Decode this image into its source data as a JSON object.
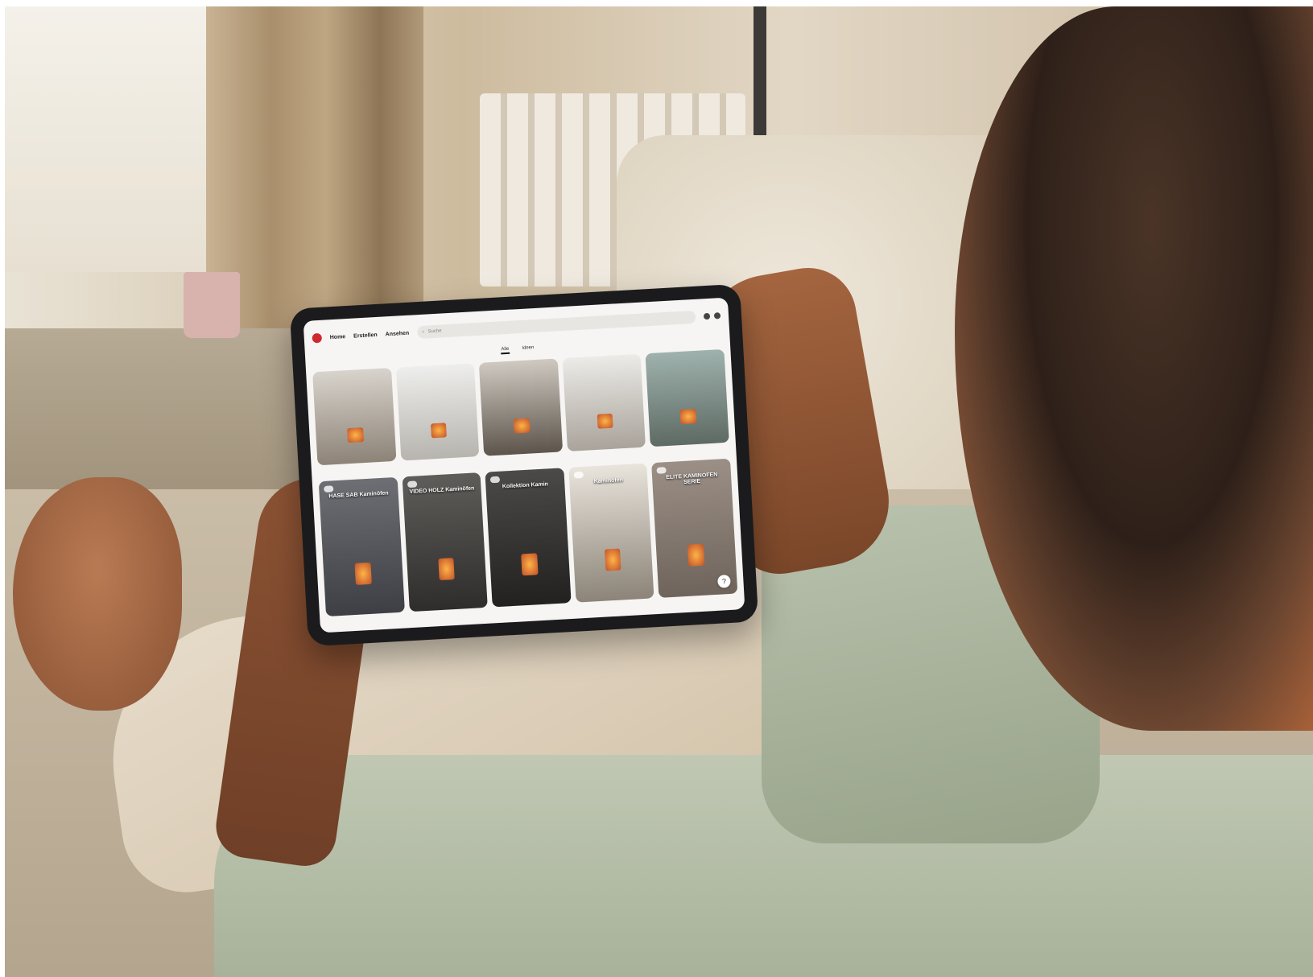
{
  "app": {
    "nav": [
      "Home",
      "Erstellen",
      "Ansehen"
    ],
    "search_placeholder": "Suche"
  },
  "tabs": [
    "Alle",
    "Ideen"
  ],
  "pins": [
    {
      "text": ""
    },
    {
      "text": ""
    },
    {
      "text": ""
    },
    {
      "text": ""
    },
    {
      "text": ""
    },
    {
      "text": "HASE SAB Kaminöfen"
    },
    {
      "text": "VIDEO HOLZ Kaminöfen"
    },
    {
      "text": "Kollektion Kamin"
    },
    {
      "text": "Kaminöfen"
    },
    {
      "text": "ELITE KAMINOFEN SERIE"
    }
  ],
  "help_label": "?"
}
